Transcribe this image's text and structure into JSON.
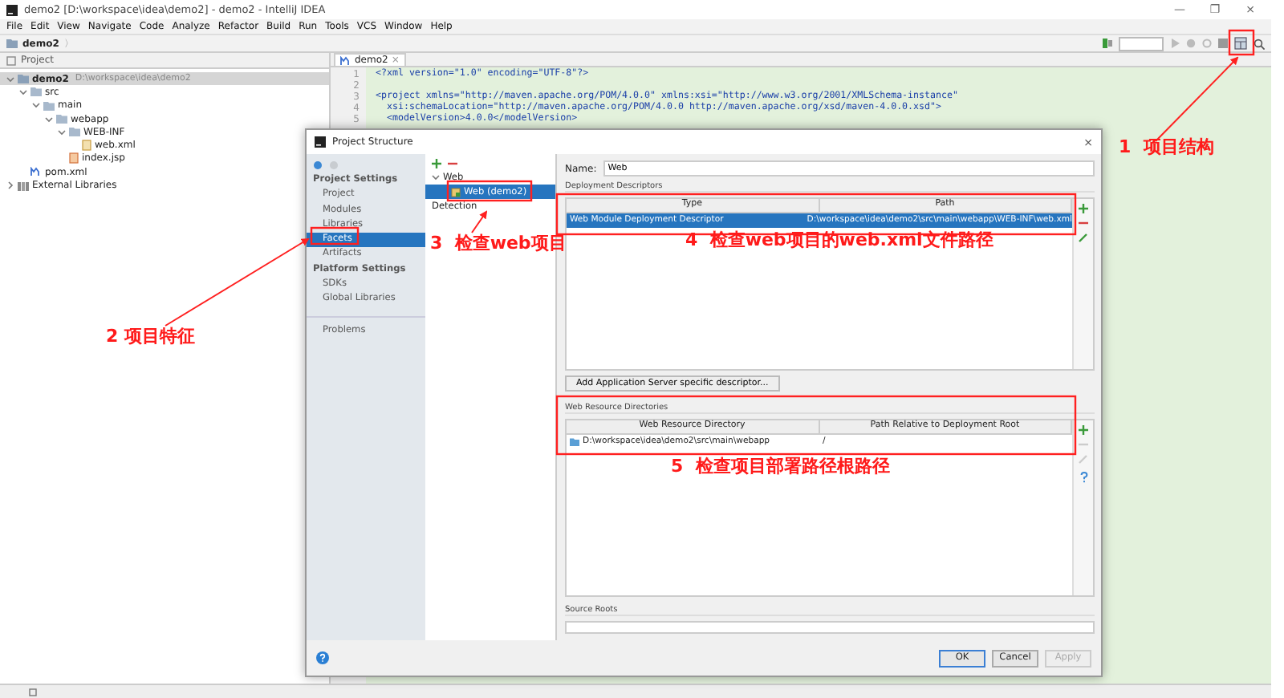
{
  "window": {
    "title": "demo2 [D:\\workspace\\idea\\demo2] - demo2 - IntelliJ IDEA",
    "controls": [
      "—",
      "❐",
      "×"
    ]
  },
  "menu": [
    "File",
    "Edit",
    "View",
    "Navigate",
    "Code",
    "Analyze",
    "Refactor",
    "Build",
    "Run",
    "Tools",
    "VCS",
    "Window",
    "Help"
  ],
  "breadcrumb": {
    "label": "demo2",
    "separator": "〉"
  },
  "project_panel": {
    "title": "Project",
    "tree": [
      {
        "label": "demo2",
        "detail": "D:\\workspace\\idea\\demo2",
        "kind": "module",
        "selected": true,
        "expanded": true,
        "children": [
          {
            "label": "src",
            "kind": "folder",
            "selected": false,
            "expanded": true,
            "children": [
              {
                "label": "main",
                "kind": "folder",
                "selected": false,
                "expanded": true,
                "children": [
                  {
                    "label": "webapp",
                    "kind": "folder",
                    "selected": false,
                    "expanded": true,
                    "children": [
                      {
                        "label": "WEB-INF",
                        "kind": "folder",
                        "selected": false,
                        "expanded": true,
                        "children": [
                          {
                            "label": "web.xml",
                            "kind": "xml",
                            "selected": false
                          }
                        ]
                      },
                      {
                        "label": "index.jsp",
                        "kind": "jsp",
                        "selected": false
                      }
                    ]
                  }
                ]
              }
            ]
          },
          {
            "label": "pom.xml",
            "kind": "maven",
            "selected": false
          }
        ]
      },
      {
        "label": "External Libraries",
        "kind": "library",
        "selected": false,
        "expanded": false
      }
    ]
  },
  "editor": {
    "tab": {
      "label": "demo2",
      "close": "×"
    },
    "lines": [
      {
        "number": "1",
        "text": "<?xml version=\"1.0\" encoding=\"UTF-8\"?>"
      },
      {
        "number": "2"
      },
      {
        "number": "3",
        "text": "<project xmlns=\"http://maven.apache.org/POM/4.0.0\" xmlns:xsi=\"http://www.w3.org/2001/XMLSchema-instance\""
      },
      {
        "number": "4",
        "text": "  xsi:schemaLocation=\"http://maven.apache.org/POM/4.0.0 http://maven.apache.org/xsd/maven-4.0.0.xsd\">"
      },
      {
        "number": "5",
        "text": "  <modelVersion>4.0.0</modelVersion>"
      }
    ]
  },
  "dialog": {
    "title": "Project Structure",
    "close": "×",
    "sidebar": [
      {
        "kind": "header",
        "label": "Project Settings"
      },
      {
        "kind": "item",
        "label": "Project",
        "selected": false
      },
      {
        "kind": "item",
        "label": "Modules",
        "selected": false
      },
      {
        "kind": "item",
        "label": "Libraries",
        "selected": false
      },
      {
        "kind": "item",
        "label": "Facets",
        "selected": true
      },
      {
        "kind": "item",
        "label": "Artifacts",
        "selected": false
      },
      {
        "kind": "header",
        "label": "Platform Settings"
      },
      {
        "kind": "item",
        "label": "SDKs",
        "selected": false
      },
      {
        "kind": "item",
        "label": "Global Libraries",
        "selected": false
      },
      {
        "kind": "footer",
        "label": "Problems",
        "selected": false
      }
    ],
    "facets": [
      {
        "label": "Web",
        "selected": false,
        "expanded": true,
        "children": [
          {
            "label": "Web (demo2)",
            "selected": true
          }
        ]
      },
      {
        "label": "Detection",
        "selected": false
      }
    ],
    "name_field": {
      "label": "Name:",
      "value": "Web"
    },
    "deployment_descriptors": {
      "title": "Deployment Descriptors",
      "columns": [
        "Type",
        "Path"
      ],
      "rows": [
        {
          "cells": [
            "Web Module Deployment Descriptor",
            "D:\\workspace\\idea\\demo2\\src\\main\\webapp\\WEB-INF\\web.xml"
          ],
          "selected": true
        }
      ]
    },
    "add_button": "Add Application Server specific descriptor...",
    "web_resource_directories": {
      "title": "Web Resource Directories",
      "columns": [
        "Web Resource Directory",
        "Path Relative to Deployment Root"
      ],
      "rows": [
        {
          "cells": [
            "D:\\workspace\\idea\\demo2\\src\\main\\webapp",
            "/"
          ],
          "selected": false
        }
      ]
    },
    "source_roots": {
      "title": "Source Roots"
    },
    "buttons": [
      {
        "label": "OK",
        "default": true,
        "disabled": false
      },
      {
        "label": "Cancel",
        "default": false,
        "disabled": false
      },
      {
        "label": "Apply",
        "default": false,
        "disabled": true
      }
    ]
  },
  "annotations": [
    {
      "text": "1  项目结构"
    },
    {
      "text": "2 项目特征"
    },
    {
      "text": "3  检查web项目"
    },
    {
      "text": "4  检查web项目的web.xml文件路径"
    },
    {
      "text": "5  检查项目部署路径根路径"
    }
  ]
}
